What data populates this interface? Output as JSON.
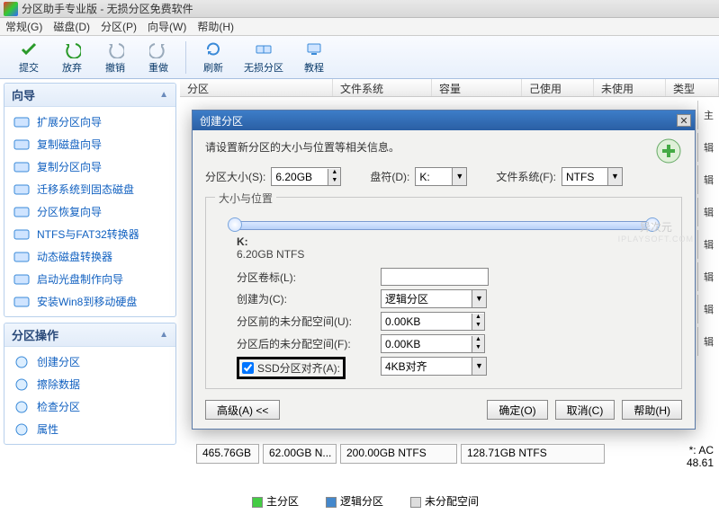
{
  "titlebar": {
    "text": "分区助手专业版 - 无损分区免费软件"
  },
  "menu": {
    "items": [
      "常规(G)",
      "磁盘(D)",
      "分区(P)",
      "向导(W)",
      "帮助(H)"
    ]
  },
  "toolbar": {
    "items": [
      {
        "label": "提交",
        "color": "#2a9a2a"
      },
      {
        "label": "放弃",
        "color": "#2a9a2a"
      },
      {
        "label": "撤销",
        "color": "#8aa0c0"
      },
      {
        "label": "重做",
        "color": "#8aa0c0"
      }
    ],
    "right": [
      {
        "label": "刷新",
        "color": "#3a8ad8"
      },
      {
        "label": "无损分区",
        "color": "#3a8ad8"
      },
      {
        "label": "教程",
        "color": "#3a8ad8"
      }
    ]
  },
  "columns": [
    "分区",
    "文件系统",
    "容量",
    "己使用",
    "未使用",
    "类型"
  ],
  "wizard": {
    "title": "向导",
    "items": [
      "扩展分区向导",
      "复制磁盘向导",
      "复制分区向导",
      "迁移系统到固态磁盘",
      "分区恢复向导",
      "NTFS与FAT32转换器",
      "动态磁盘转换器",
      "启动光盘制作向导",
      "安装Win8到移动硬盘"
    ]
  },
  "ops": {
    "title": "分区操作",
    "items": [
      "创建分区",
      "擦除数据",
      "检查分区",
      "属性"
    ]
  },
  "dialog": {
    "title": "创建分区",
    "desc": "请设置新分区的大小与位置等相关信息。",
    "size_label": "分区大小(S):",
    "size_value": "6.20GB",
    "drive_label": "盘符(D):",
    "drive_value": "K:",
    "fs_label": "文件系统(F):",
    "fs_value": "NTFS",
    "group_label": "大小与位置",
    "slider_title": "K:",
    "slider_sub": "6.20GB NTFS",
    "vol_label": "分区卷标(L):",
    "vol_value": "",
    "create_label": "创建为(C):",
    "create_value": "逻辑分区",
    "before_label": "分区前的未分配空间(U):",
    "before_value": "0.00KB",
    "after_label": "分区后的未分配空间(F):",
    "after_value": "0.00KB",
    "ssd_label": "SSD分区对齐(A):",
    "ssd_value": "4KB对齐",
    "adv_btn": "高级(A) <<",
    "ok": "确定(O)",
    "cancel": "取消(C)",
    "help": "帮助(H)"
  },
  "watermark": {
    "t1": "异次元",
    "t2": "IPLAYSOFT.COM"
  },
  "disks": {
    "row": [
      "465.76GB",
      "62.00GB N...",
      "200.00GB NTFS",
      "128.71GB NTFS"
    ],
    "tail_label": "*: AC",
    "tail_val": "48.61"
  },
  "legend": {
    "a": "主分区",
    "b": "逻辑分区",
    "c": "未分配空间"
  },
  "rightedge": [
    "主",
    "辑",
    "辑",
    "辑",
    "辑",
    "辑",
    "辑",
    "辑"
  ]
}
